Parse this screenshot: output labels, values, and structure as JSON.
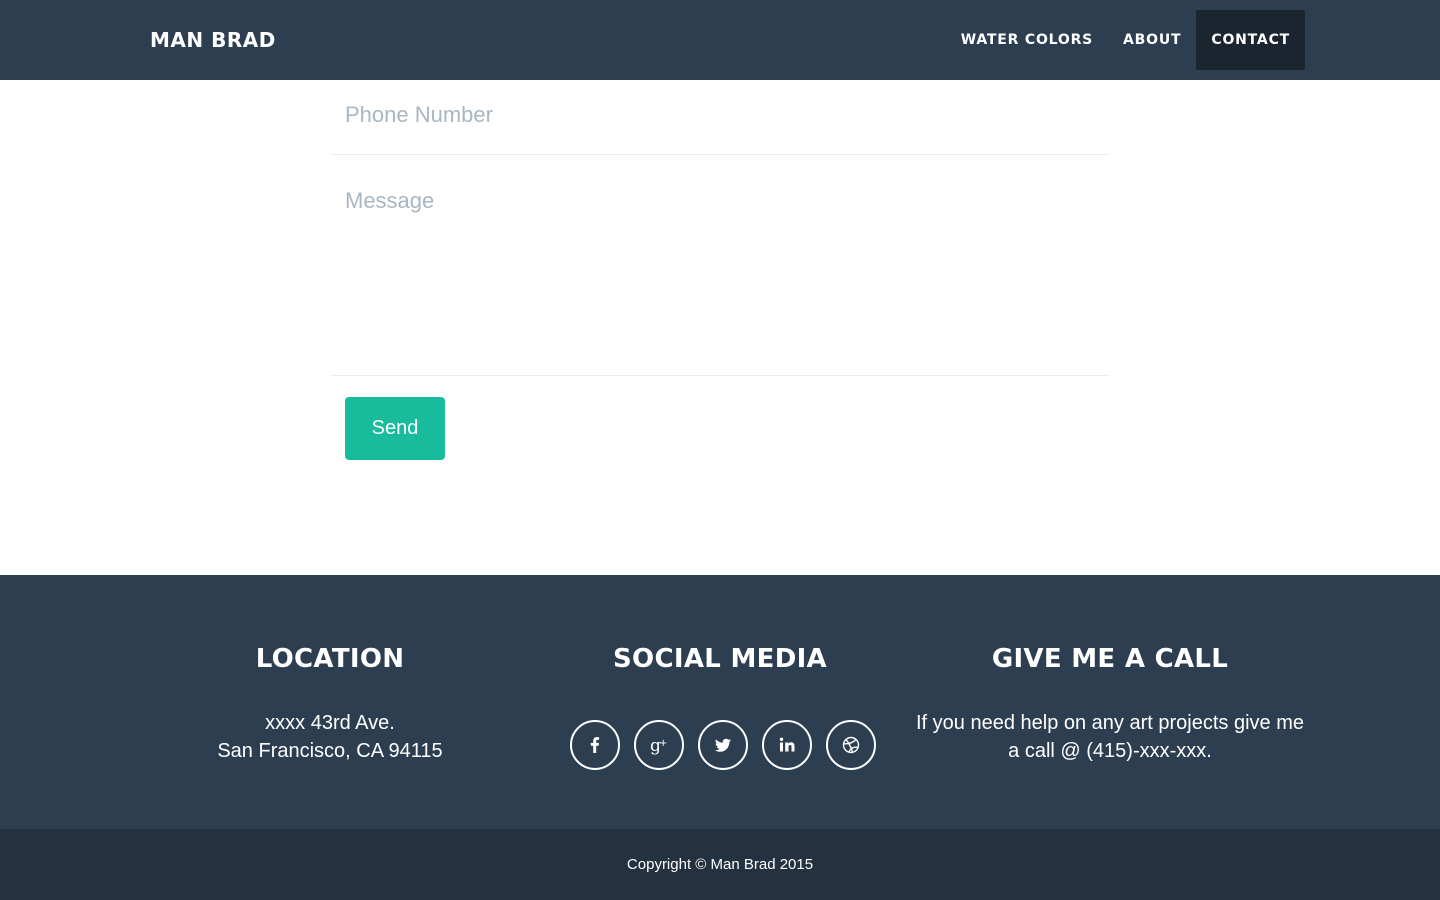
{
  "navbar": {
    "brand": "MAN BRAD",
    "items": [
      {
        "label": "WATER COLORS",
        "active": false
      },
      {
        "label": "ABOUT",
        "active": false
      },
      {
        "label": "CONTACT",
        "active": true
      }
    ]
  },
  "form": {
    "phone_placeholder": "Phone Number",
    "message_placeholder": "Message",
    "send_label": "Send"
  },
  "footer": {
    "location": {
      "title": "LOCATION",
      "line1": "xxxx 43rd Ave.",
      "line2": "San Francisco, CA 94115"
    },
    "social": {
      "title": "SOCIAL MEDIA",
      "icons": [
        "facebook-icon",
        "google-plus-icon",
        "twitter-icon",
        "linkedin-icon",
        "dribbble-icon"
      ]
    },
    "call": {
      "title": "GIVE ME A CALL",
      "text": "If you need help on any art projects give me a call @ (415)-xxx-xxx."
    },
    "copyright": "Copyright © Man Brad 2015"
  },
  "colors": {
    "primary": "#2c3e50",
    "nav_active": "#1a252f",
    "accent": "#18bc9c",
    "bottom_bar": "#233140",
    "placeholder": "#a9b7c2"
  }
}
